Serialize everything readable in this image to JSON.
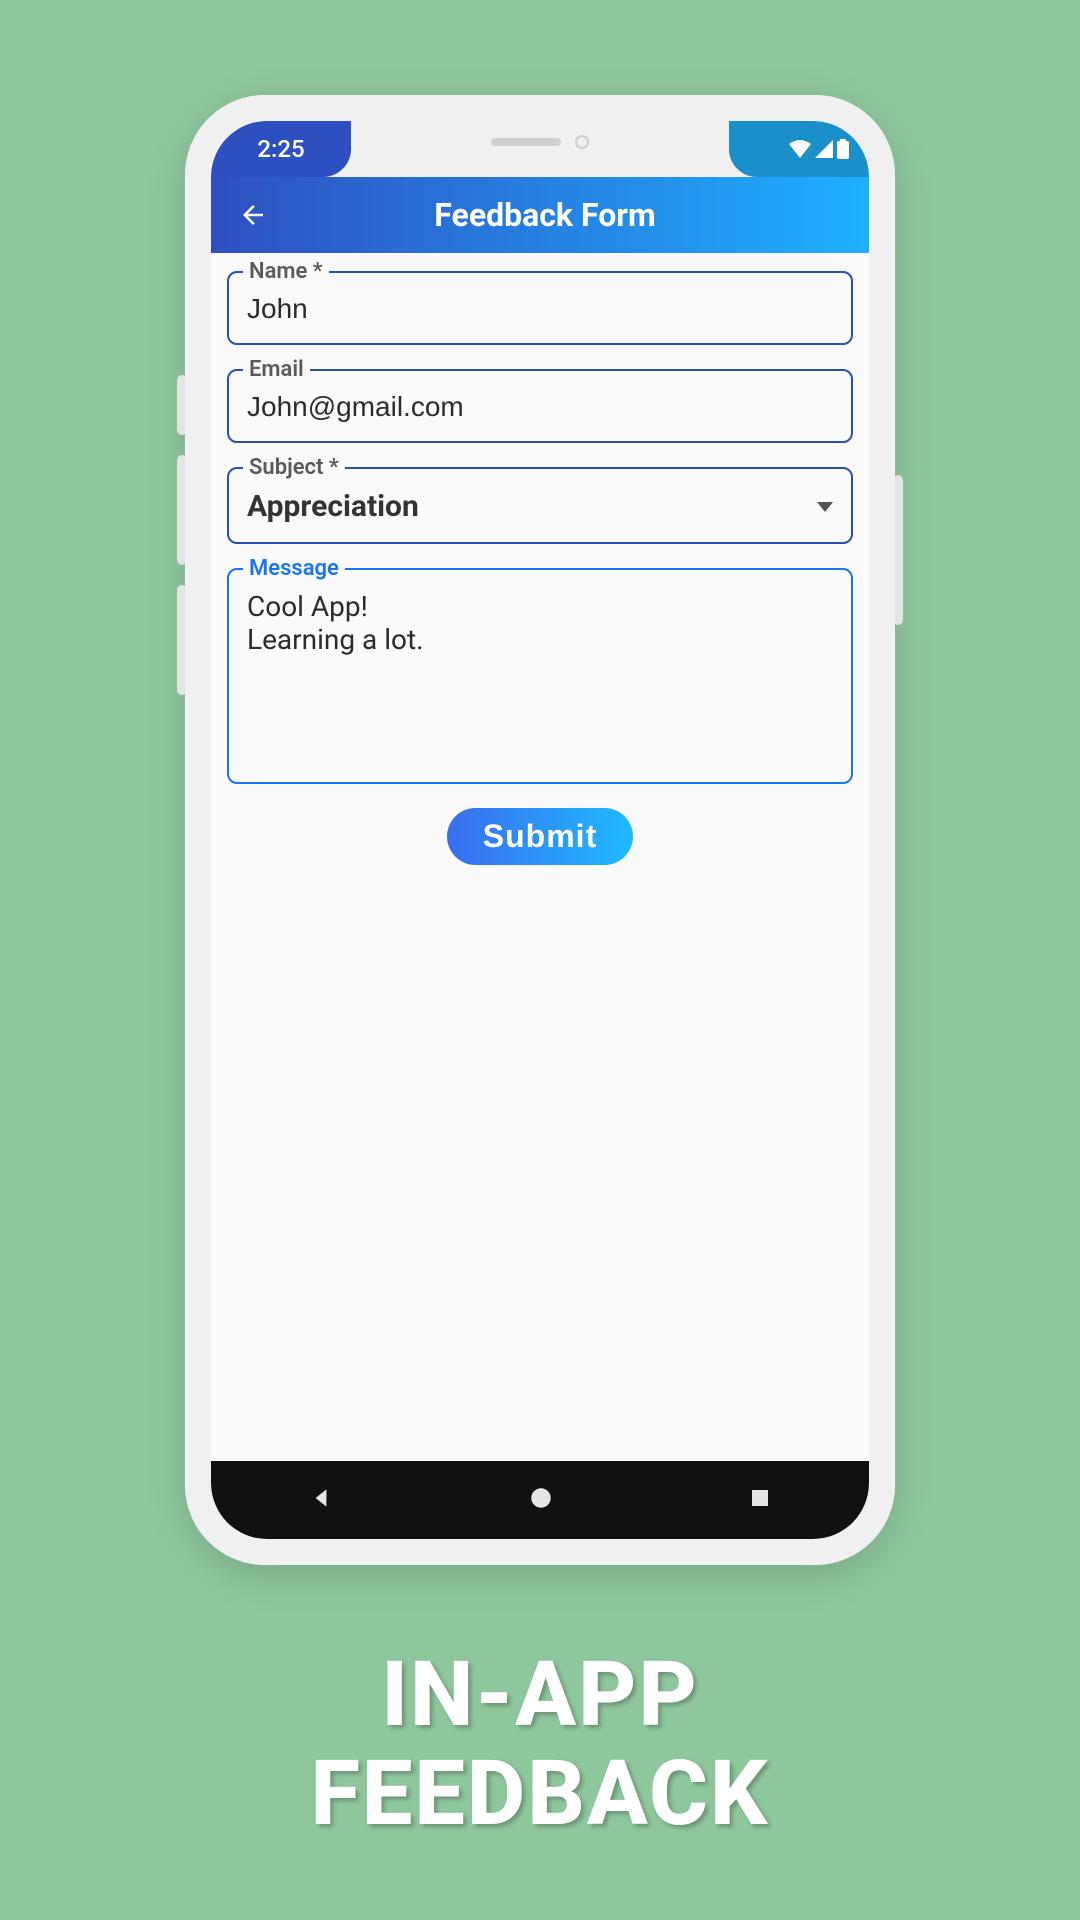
{
  "statusbar": {
    "time": "2:25"
  },
  "appbar": {
    "title": "Feedback Form"
  },
  "form": {
    "name": {
      "label": "Name *",
      "value": "John"
    },
    "email": {
      "label": "Email",
      "value": "John@gmail.com"
    },
    "subject": {
      "label": "Subject *",
      "value": "Appreciation"
    },
    "message": {
      "label": "Message",
      "value": "Cool App!\nLearning a lot."
    },
    "submit_label": "Submit"
  },
  "marketing": {
    "line1": "IN-APP",
    "line2": "FEEDBACK"
  }
}
